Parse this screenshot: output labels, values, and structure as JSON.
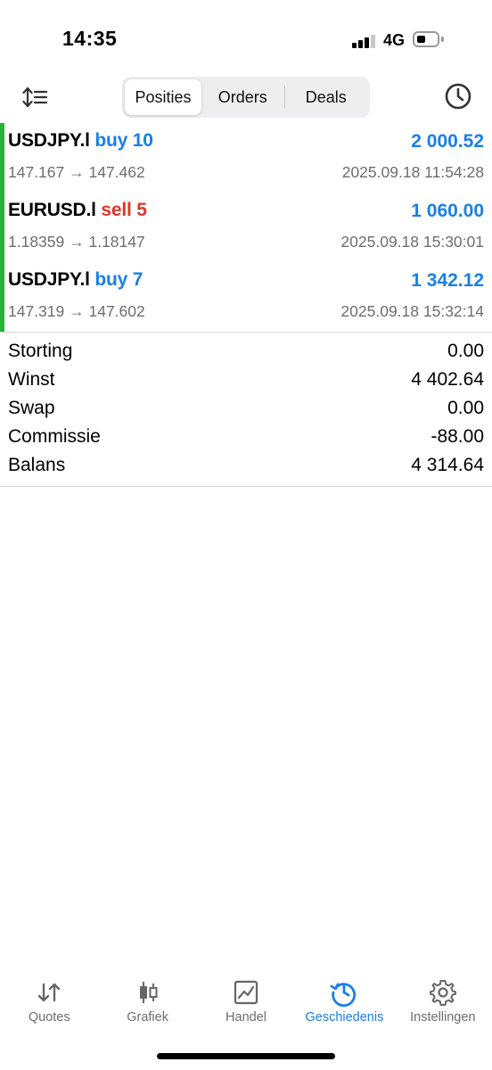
{
  "status_bar": {
    "time": "14:35",
    "network": "4G"
  },
  "toolbar": {
    "tabs": [
      {
        "label": "Posities"
      },
      {
        "label": "Orders"
      },
      {
        "label": "Deals"
      }
    ],
    "active_tab": "Posities",
    "sort_icon": "sort-icon",
    "history_icon": "clock-icon"
  },
  "deals": [
    {
      "symbol": "USDJPY.l",
      "side": "buy 10",
      "side_type": "buy",
      "profit": "2 000.52",
      "prices": "147.167 → 147.462",
      "time": "2025.09.18 11:54:28"
    },
    {
      "symbol": "EURUSD.l",
      "side": "sell 5",
      "side_type": "sell",
      "profit": "1 060.00",
      "prices": "1.18359 → 1.18147",
      "time": "2025.09.18 15:30:01"
    },
    {
      "symbol": "USDJPY.l",
      "side": "buy 7",
      "side_type": "buy",
      "profit": "1 342.12",
      "prices": "147.319 → 147.602",
      "time": "2025.09.18 15:32:14"
    }
  ],
  "summary": [
    {
      "label": "Storting",
      "value": "0.00"
    },
    {
      "label": "Winst",
      "value": "4 402.64"
    },
    {
      "label": "Swap",
      "value": "0.00"
    },
    {
      "label": "Commissie",
      "value": "-88.00"
    },
    {
      "label": "Balans",
      "value": "4 314.64"
    }
  ],
  "tabbar": [
    {
      "label": "Quotes",
      "icon": "arrows-updown-icon"
    },
    {
      "label": "Grafiek",
      "icon": "candlestick-icon"
    },
    {
      "label": "Handel",
      "icon": "trade-chart-icon"
    },
    {
      "label": "Geschiedenis",
      "icon": "history-icon",
      "active": true
    },
    {
      "label": "Instellingen",
      "icon": "gear-icon"
    }
  ],
  "colors": {
    "accent": "#1a7fe6",
    "buy": "#1a7fe6",
    "sell": "#e0352b",
    "position_bar": "#23b436"
  }
}
